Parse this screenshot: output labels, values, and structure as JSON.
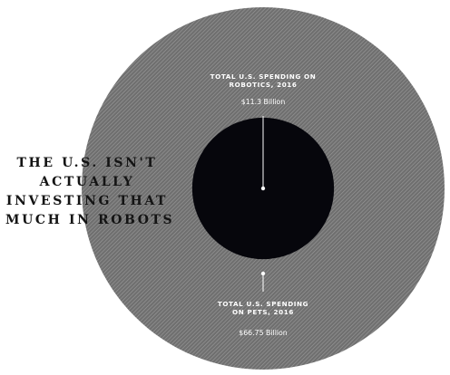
{
  "headline": {
    "lines": [
      "THE U.S. ISN'T",
      "ACTUALLY",
      "INVESTING THAT",
      "MUCH IN ROBOTS"
    ]
  },
  "colors": {
    "outer_fill": "#6f6f6f",
    "outer_hatch": "#9b9b9b",
    "inner_fill": "#06060c",
    "headline": "#141414",
    "label_text": "#ffffff",
    "leader_line": "#ffffff"
  },
  "chart_data": {
    "type": "area",
    "unit": "Billion",
    "items": [
      {
        "name": "TOTAL U.S. SPENDING ON ROBOTICS, 2016",
        "title_lines": [
          "TOTAL U.S. SPENDING ON",
          "ROBOTICS, 2016"
        ],
        "value": 11.3,
        "value_label": "$11.3 Billion",
        "role": "inner"
      },
      {
        "name": "TOTAL U.S. SPENDING ON PETS, 2016",
        "title_lines": [
          "TOTAL U.S. SPENDING",
          "ON PETS, 2016"
        ],
        "value": 66.75,
        "value_label": "$66.75 Billion",
        "role": "outer"
      }
    ]
  }
}
